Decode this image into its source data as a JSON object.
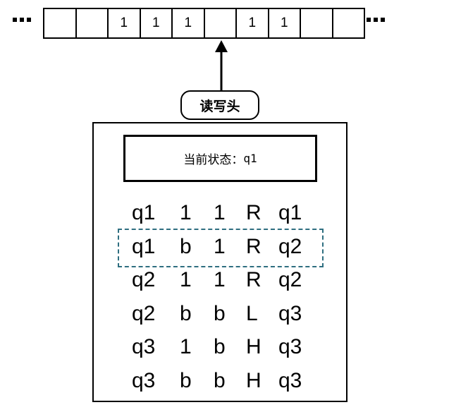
{
  "tape": {
    "cells": [
      "",
      "",
      "1",
      "1",
      "1",
      "",
      "1",
      "1",
      "",
      ""
    ]
  },
  "head": {
    "label": "读写头"
  },
  "machine": {
    "state_label": "当前状态：",
    "state_value": "q1",
    "highlighted_rule_index": 1,
    "rules": [
      [
        "q1",
        "1",
        "1",
        "R",
        "q1"
      ],
      [
        "q1",
        "b",
        "1",
        "R",
        "q2"
      ],
      [
        "q2",
        "1",
        "1",
        "R",
        "q2"
      ],
      [
        "q2",
        "b",
        "b",
        "L",
        "q3"
      ],
      [
        "q3",
        "1",
        "b",
        "H",
        "q3"
      ],
      [
        "q3",
        "b",
        "b",
        "H",
        "q3"
      ]
    ]
  },
  "colors": {
    "highlight_border": "#2e6e80"
  },
  "icons": {
    "left_ellipsis": "ellipsis-icon",
    "right_ellipsis": "ellipsis-icon",
    "pointer": "up-arrow-icon"
  }
}
